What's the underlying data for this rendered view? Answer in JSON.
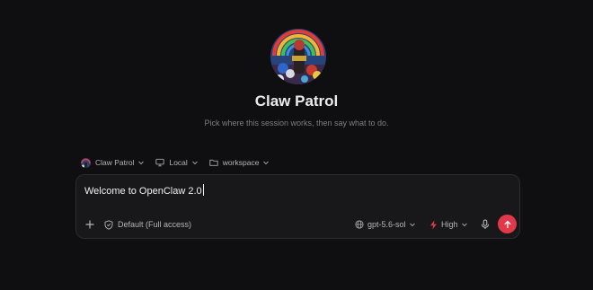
{
  "agent": {
    "name": "Claw Patrol",
    "subtitle": "Pick where this session works, then say what to do."
  },
  "context": {
    "agent_label": "Claw Patrol",
    "environment_label": "Local",
    "folder_label": "workspace"
  },
  "composer": {
    "message": "Welcome to OpenClaw 2.0",
    "permissions_label": "Default (Full access)",
    "model_label": "gpt-5.6-sol",
    "effort_label": "High"
  },
  "colors": {
    "background": "#0f0f11",
    "composer_bg": "#18181b",
    "send_button": "#e2394a",
    "effort_icon": "#e2394a"
  },
  "icons": {
    "context": [
      "avatar",
      "monitor-icon",
      "folder-icon",
      "chevron-down-icon"
    ],
    "composer": [
      "plus-icon",
      "shield-icon",
      "globe-icon",
      "bolt-icon",
      "mic-icon",
      "arrow-up-icon"
    ]
  }
}
